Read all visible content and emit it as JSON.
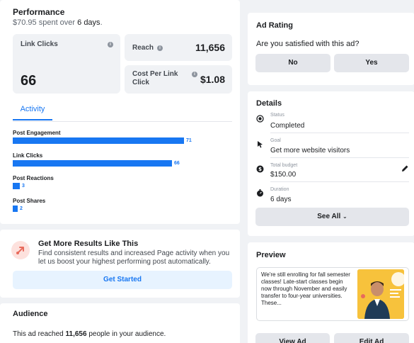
{
  "performance": {
    "title": "Performance",
    "spent": "$70.95",
    "spent_mid": " spent over ",
    "days": "6 days",
    "spent_end": ".",
    "link_clicks_label": "Link Clicks",
    "link_clicks_value": "66",
    "reach_label": "Reach",
    "reach_value": "11,656",
    "cpc_label_1": "Cost Per Link",
    "cpc_label_2": "Click",
    "cpc_value": "$1.08",
    "tab_label": "Activity"
  },
  "chart_data": {
    "type": "bar",
    "orientation": "horizontal",
    "categories": [
      "Post Engagement",
      "Link Clicks",
      "Post Reactions",
      "Post Shares"
    ],
    "values": [
      71,
      66,
      3,
      2
    ],
    "value_labels": [
      "71",
      "66",
      "3",
      "2"
    ],
    "xlim": [
      0,
      71
    ],
    "grid": false,
    "colors": [
      "#1877f2"
    ]
  },
  "more_results": {
    "title": "Get More Results Like This",
    "description": "Find consistent results and increased Page activity when you let us boost your highest performing post automatically.",
    "button": "Get Started"
  },
  "audience": {
    "title": "Audience",
    "text_pre": "This ad reached ",
    "count": "11,656",
    "text_post": " people in your audience."
  },
  "ad_rating": {
    "title": "Ad Rating",
    "question": "Are you satisfied with this ad?",
    "no_label": "No",
    "yes_label": "Yes"
  },
  "details": {
    "title": "Details",
    "items": [
      {
        "label": "Status",
        "value": "Completed",
        "icon": "status-icon"
      },
      {
        "label": "Goal",
        "value": "Get more website visitors",
        "icon": "cursor-icon"
      },
      {
        "label": "Total budget",
        "value": "$150.00",
        "icon": "budget-icon"
      },
      {
        "label": "Duration",
        "value": "6 days",
        "icon": "stopwatch-icon"
      }
    ],
    "see_all": "See All"
  },
  "preview": {
    "title": "Preview",
    "text": "We're still enrolling for fall semester classes! Late-start classes begin now through November and easily transfer to four-year universities. These...",
    "view_label": "View Ad",
    "edit_label": "Edit Ad"
  },
  "colors": {
    "accent": "#1877f2",
    "page_bg": "#f0f2f5",
    "card_bg": "#ffffff",
    "button_gray": "#e4e6eb",
    "button_light_blue": "#e7f3ff"
  }
}
